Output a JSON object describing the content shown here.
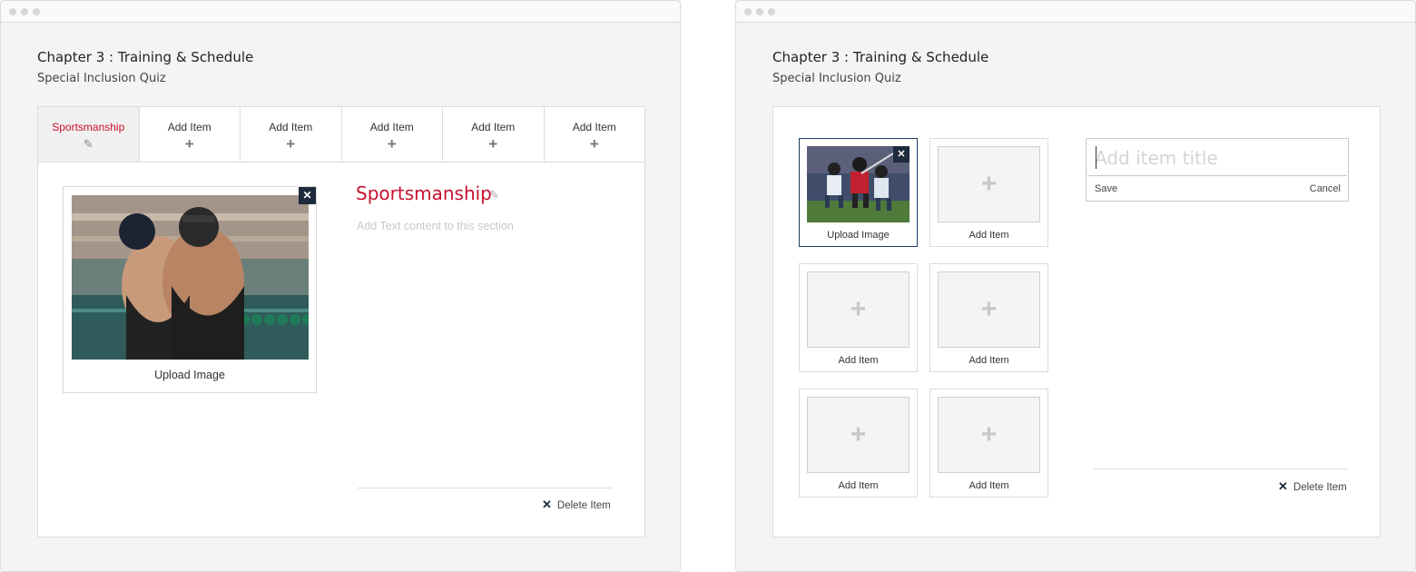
{
  "left_window": {
    "chapter_title": "Chapter 3 : Training & Schedule",
    "chapter_subtitle": "Special Inclusion Quiz",
    "tabs": [
      {
        "label": "Sportsmanship",
        "icon": "pencil-icon",
        "active": true
      },
      {
        "label": "Add Item",
        "icon": "plus-icon"
      },
      {
        "label": "Add Item",
        "icon": "plus-icon"
      },
      {
        "label": "Add Item",
        "icon": "plus-icon"
      },
      {
        "label": "Add Item",
        "icon": "plus-icon"
      },
      {
        "label": "Add Item",
        "icon": "plus-icon"
      }
    ],
    "image_card": {
      "caption": "Upload Image",
      "image": "swimmers-hugging-photo"
    },
    "item_heading": "Sportsmanship",
    "text_placeholder": "Add Text content to this section",
    "delete_label": "Delete Item"
  },
  "right_window": {
    "chapter_title": "Chapter 3 : Training & Schedule",
    "chapter_subtitle": "Special Inclusion Quiz",
    "grid_items": [
      {
        "caption": "Upload Image",
        "image": "lacrosse-players-photo",
        "selected": true
      },
      {
        "caption": "Add Item"
      },
      {
        "caption": "Add Item"
      },
      {
        "caption": "Add Item"
      },
      {
        "caption": "Add Item"
      },
      {
        "caption": "Add Item"
      }
    ],
    "title_editor": {
      "placeholder": "Add item title",
      "save_label": "Save",
      "cancel_label": "Cancel"
    },
    "delete_label": "Delete Item"
  },
  "colors": {
    "accent_red": "#c8102e",
    "navy": "#1d2b3c",
    "border": "#dcdcdc",
    "window_bg": "#f4f4f4"
  }
}
